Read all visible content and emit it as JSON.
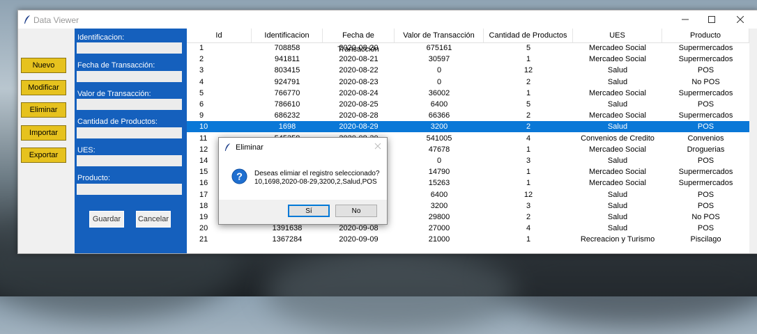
{
  "window": {
    "title": "Data Viewer"
  },
  "left_buttons": [
    {
      "label": "Nuevo"
    },
    {
      "label": "Modificar"
    },
    {
      "label": "Eliminar"
    },
    {
      "label": "Importar"
    },
    {
      "label": "Exportar"
    }
  ],
  "form": {
    "fields": [
      {
        "label": "Identificacion:",
        "value": ""
      },
      {
        "label": "Fecha de Transacción:",
        "value": ""
      },
      {
        "label": "Valor de Transacción:",
        "value": ""
      },
      {
        "label": "Cantidad de Productos:",
        "value": ""
      },
      {
        "label": "UES:",
        "value": ""
      },
      {
        "label": "Producto:",
        "value": ""
      }
    ],
    "save_label": "Guardar",
    "cancel_label": "Cancelar"
  },
  "table": {
    "columns": [
      "Id",
      "Identificacion",
      "Fecha de Transacción",
      "Valor de Transacción",
      "Cantidad de Productos",
      "UES",
      "Producto"
    ],
    "selected_row_index": 7,
    "rows": [
      [
        "1",
        "708858",
        "2020-08-20",
        "675161",
        "5",
        "Mercadeo Social",
        "Supermercados"
      ],
      [
        "2",
        "941811",
        "2020-08-21",
        "30597",
        "1",
        "Mercadeo Social",
        "Supermercados"
      ],
      [
        "3",
        "803415",
        "2020-08-22",
        "0",
        "12",
        "Salud",
        "POS"
      ],
      [
        "4",
        "924791",
        "2020-08-23",
        "0",
        "2",
        "Salud",
        "No POS"
      ],
      [
        "5",
        "766770",
        "2020-08-24",
        "36002",
        "1",
        "Mercadeo Social",
        "Supermercados"
      ],
      [
        "6",
        "786610",
        "2020-08-25",
        "6400",
        "5",
        "Salud",
        "POS"
      ],
      [
        "9",
        "686232",
        "2020-08-28",
        "66366",
        "2",
        "Mercadeo Social",
        "Supermercados"
      ],
      [
        "10",
        "1698",
        "2020-08-29",
        "3200",
        "2",
        "Salud",
        "POS"
      ],
      [
        "11",
        "545358",
        "2020-08-30",
        "541005",
        "4",
        "Convenios de Credito",
        "Convenios"
      ],
      [
        "12",
        "",
        "",
        "47678",
        "1",
        "Mercadeo Social",
        "Droguerias"
      ],
      [
        "14",
        "",
        "",
        "0",
        "3",
        "Salud",
        "POS"
      ],
      [
        "15",
        "",
        "",
        "14790",
        "1",
        "Mercadeo Social",
        "Supermercados"
      ],
      [
        "16",
        "",
        "",
        "15263",
        "1",
        "Mercadeo Social",
        "Supermercados"
      ],
      [
        "17",
        "",
        "",
        "6400",
        "12",
        "Salud",
        "POS"
      ],
      [
        "18",
        "",
        "",
        "3200",
        "3",
        "Salud",
        "POS"
      ],
      [
        "19",
        "",
        "",
        "29800",
        "2",
        "Salud",
        "No POS"
      ],
      [
        "20",
        "1391638",
        "2020-09-08",
        "27000",
        "4",
        "Salud",
        "POS"
      ],
      [
        "21",
        "1367284",
        "2020-09-09",
        "21000",
        "1",
        "Recreacion y Turismo",
        "Piscilago"
      ]
    ]
  },
  "dialog": {
    "title": "Eliminar",
    "message_line1": "Deseas elimiar el registro seleccionado?",
    "message_line2": "10,1698,2020-08-29,3200,2,Salud,POS",
    "yes_label": "Sí",
    "no_label": "No"
  },
  "colors": {
    "accent_blue": "#1560bd",
    "selection": "#0a78d7",
    "button_yellow": "#e6c21e"
  }
}
